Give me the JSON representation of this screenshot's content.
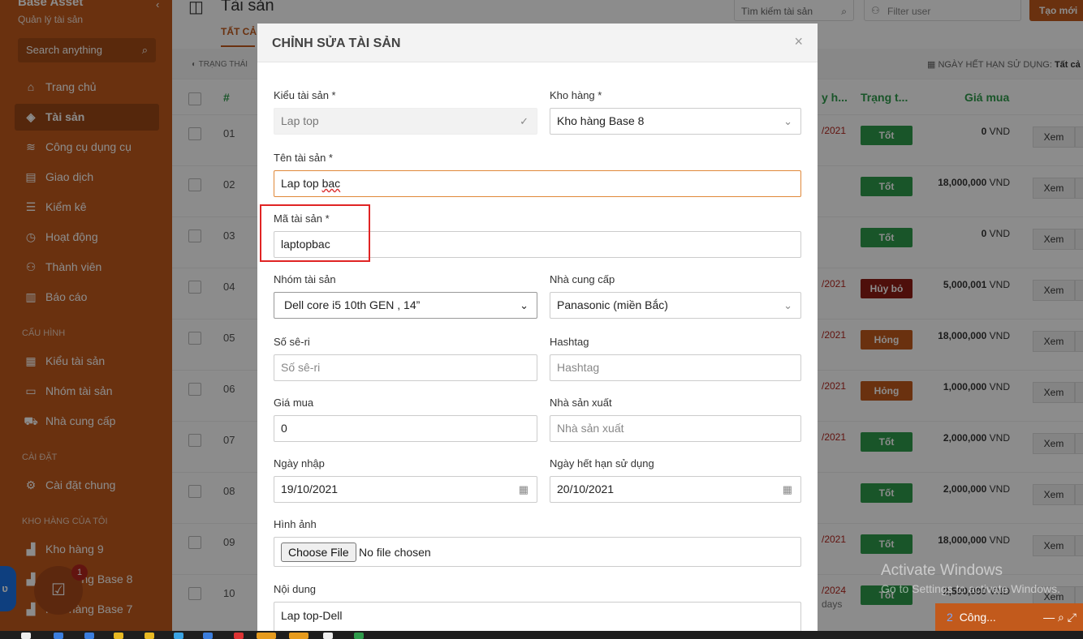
{
  "sidebar": {
    "brand": "Base Asset",
    "subtitle": "Quản lý tài sản",
    "search_placeholder": "Search anything",
    "nav": [
      {
        "label": "Trang chủ",
        "icon": "home-icon"
      },
      {
        "label": "Tài sản",
        "icon": "box-icon",
        "active": true
      },
      {
        "label": "Công cụ dụng cụ",
        "icon": "layers-icon"
      },
      {
        "label": "Giao dịch",
        "icon": "transaction-icon"
      },
      {
        "label": "Kiểm kê",
        "icon": "checklist-icon"
      },
      {
        "label": "Hoạt động",
        "icon": "history-icon"
      },
      {
        "label": "Thành viên",
        "icon": "users-icon"
      },
      {
        "label": "Báo cáo",
        "icon": "chart-icon"
      }
    ],
    "config_label": "CẤU HÌNH",
    "config_items": [
      {
        "label": "Kiểu tài sản",
        "icon": "table-icon"
      },
      {
        "label": "Nhóm tài sản",
        "icon": "folder-icon"
      },
      {
        "label": "Nhà cung cấp",
        "icon": "truck-icon"
      }
    ],
    "settings_label": "CÀI ĐẶT",
    "settings_items": [
      {
        "label": "Cài đặt chung",
        "icon": "gear-icon"
      }
    ],
    "warehouse_label": "KHO HÀNG CỦA TÔI",
    "warehouse_items": [
      {
        "label": "Kho hàng 9",
        "icon": "warehouse-icon"
      },
      {
        "label": "Kho hàng Base 8",
        "icon": "warehouse-icon"
      },
      {
        "label": "Kho hàng Base 7",
        "icon": "warehouse-icon"
      }
    ],
    "fab_badge": "1"
  },
  "header": {
    "title": "Tài sản",
    "tab_all": "TẤT CẢ",
    "search_placeholder": "Tìm kiếm tài sản",
    "filter_user": "Filter user",
    "create_button": "Tạo mới",
    "status_filter": "TRẠNG THÁI",
    "expire_filter_label": "NGÀY HẾT HẠN SỬ DỤNG:",
    "expire_filter_value": "Tất cả"
  },
  "table": {
    "headers": {
      "num": "#",
      "expire": "y h...",
      "status": "Trạng t...",
      "price": "Giá mua"
    },
    "view_label": "Xem",
    "rows": [
      {
        "num": "01",
        "date": "/2021",
        "status": "Tốt",
        "price": "0",
        "currency": "VND"
      },
      {
        "num": "02",
        "date": "",
        "status": "Tốt",
        "price": "18,000,000",
        "currency": "VND"
      },
      {
        "num": "03",
        "date": "",
        "status": "Tốt",
        "price": "0",
        "currency": "VND"
      },
      {
        "num": "04",
        "date": "/2021",
        "status": "Hủy bỏ",
        "price": "5,000,001",
        "currency": "VND"
      },
      {
        "num": "05",
        "date": "/2021",
        "status": "Hỏng",
        "price": "18,000,000",
        "currency": "VND"
      },
      {
        "num": "06",
        "date": "/2021",
        "status": "Hỏng",
        "price": "1,000,000",
        "currency": "VND"
      },
      {
        "num": "07",
        "date": "/2021",
        "status": "Tốt",
        "price": "2,000,000",
        "currency": "VND"
      },
      {
        "num": "08",
        "date": "",
        "status": "Tốt",
        "price": "2,000,000",
        "currency": "VND"
      },
      {
        "num": "09",
        "date": "/2021",
        "status": "Tốt",
        "price": "18,000,000",
        "currency": "VND"
      },
      {
        "num": "10",
        "date": "/2024",
        "days": "days",
        "status": "Tốt",
        "price": "2,500,000",
        "currency": "VND"
      }
    ]
  },
  "modal": {
    "title": "CHỈNH SỬA TÀI SẢN",
    "fields": {
      "asset_type_label": "Kiểu tài sản *",
      "asset_type_value": "Lap top",
      "warehouse_label": "Kho hàng *",
      "warehouse_value": "Kho hàng Base 8",
      "name_label": "Tên tài sản *",
      "name_value_plain": "Lap top ",
      "name_value_misspelled": "bac",
      "code_label": "Mã tài sản *",
      "code_value": "laptopbac",
      "group_label": "Nhóm tài sản",
      "group_value": "Dell core i5 10th GEN , 14”",
      "supplier_label": "Nhà cung cấp",
      "supplier_value": "Panasonic (miền Bắc)",
      "serial_label": "Số sê-ri",
      "serial_placeholder": "Số sê-ri",
      "hashtag_label": "Hashtag",
      "hashtag_placeholder": "Hashtag",
      "price_label": "Giá mua",
      "price_value": "0",
      "manufacturer_label": "Nhà sản xuất",
      "manufacturer_placeholder": "Nhà sản xuất",
      "import_date_label": "Ngày nhập",
      "import_date_value": "19/10/2021",
      "expire_date_label": "Ngày hết hạn sử dụng",
      "expire_date_value": "20/10/2021",
      "image_label": "Hình ảnh",
      "choose_file": "Choose File",
      "no_file": "No file chosen",
      "content_label": "Nội dung",
      "content_value": "Lap top-Dell"
    }
  },
  "chat": {
    "count": "2",
    "label": "Công..."
  },
  "watermark": {
    "line1": "Activate Windows",
    "line2": "Go to Settings to activate Windows."
  },
  "colors": {
    "brand": "#c25a1c",
    "good": "#2e9b4b",
    "cancel": "#8e1c14",
    "highlight": "#e02424"
  }
}
